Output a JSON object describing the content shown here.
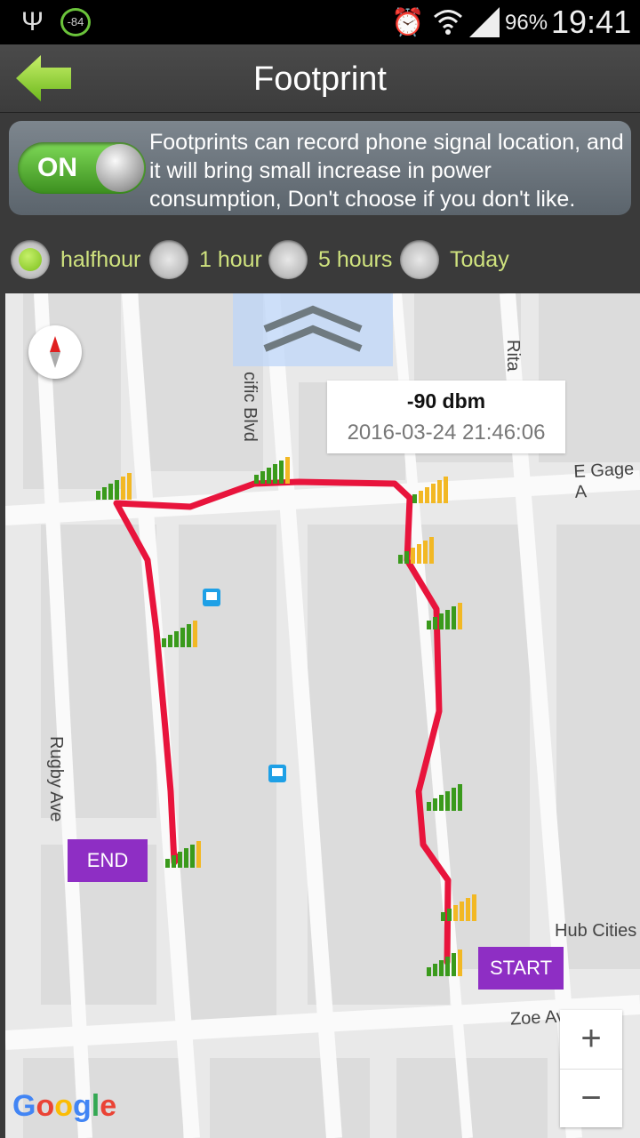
{
  "status_bar": {
    "signal_badge": "-84",
    "battery": "96%",
    "time": "19:41"
  },
  "header": {
    "title": "Footprint"
  },
  "footprint_toggle": {
    "state": "ON",
    "description": "Footprints can record phone signal location, and it will bring small increase in power consumption, Don't choose if you don't like."
  },
  "time_range": {
    "options": [
      "halfhour",
      "1 hour",
      "5 hours",
      "Today"
    ],
    "selected": "halfhour"
  },
  "map": {
    "tooltip": {
      "signal": "-90 dbm",
      "timestamp": "2016-03-24 21:46:06"
    },
    "end_label": "END",
    "start_label": "START",
    "streets": [
      "cific Blvd",
      "Rita",
      "E Gage A",
      "Rugby Ave",
      "Hub Cities",
      "Zoe Av"
    ],
    "zoom_in": "+",
    "zoom_out": "−",
    "logo": "Google",
    "colors": {
      "route": "#e8143c",
      "signal_green": "#3a9a1c",
      "signal_yellow": "#f2b824"
    }
  }
}
